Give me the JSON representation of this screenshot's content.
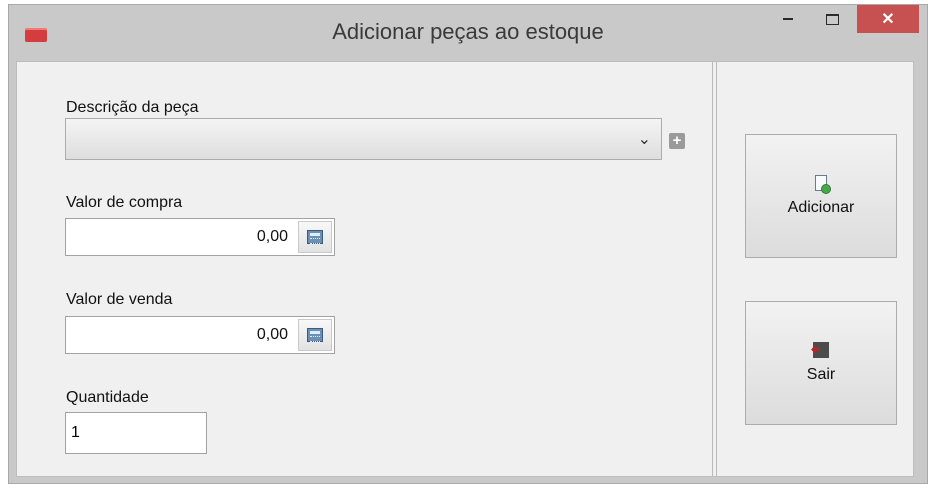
{
  "window": {
    "title": "Adicionar peças ao estoque"
  },
  "form": {
    "description_label": "Descrição da peça",
    "purchase_label": "Valor de compra",
    "purchase_value": "0,00",
    "sale_label": "Valor de venda",
    "sale_value": "0,00",
    "quantity_label": "Quantidade",
    "quantity_value": "1"
  },
  "actions": {
    "add_label": "Adicionar",
    "exit_label": "Sair"
  },
  "icons": {
    "app": "app-icon",
    "dropdown": "chevron-down-icon",
    "plus": "plus-icon",
    "calculator": "calculator-icon",
    "add": "add-document-icon",
    "exit": "exit-door-icon"
  },
  "colors": {
    "close_button": "#c75050"
  }
}
